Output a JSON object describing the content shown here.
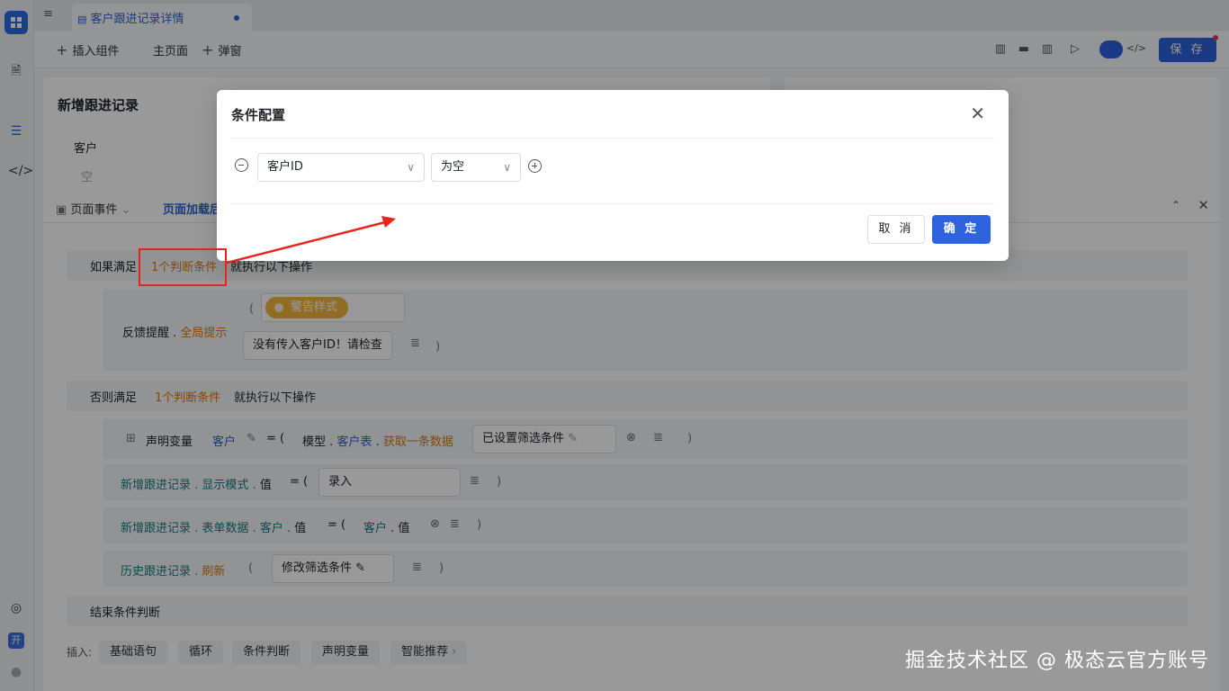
{
  "app": {
    "tab_title": "客户跟进记录详情",
    "open_badge": "开"
  },
  "toolbar": {
    "insert_component": "插入组件",
    "main_page": "主页面",
    "popup": "弹窗",
    "save": "保 存"
  },
  "canvas": {
    "title": "新增跟进记录",
    "field_label": "客户",
    "field_empty": "空"
  },
  "panel": {
    "tab_page_event": "页面事件",
    "tab_page_load": "页面加载后",
    "if_prefix": "如果满足",
    "if_condition": "1个判断条件",
    "if_suffix": "就执行以下操作",
    "feedback_label": "反馈提醒",
    "feedback_method": "全局提示",
    "warn_style": "警告样式",
    "warn_message": "没有传入客户ID！请检查",
    "else_prefix": "否则满足",
    "else_condition": "1个判断条件",
    "else_suffix": "就执行以下操作",
    "declare_label": "声明变量",
    "declare_var": "客户",
    "model_label": "模型",
    "model_table": "客户表",
    "model_action": "获取一条数据",
    "filter_set": "已设置筛选条件",
    "row2_target": "新增跟进记录",
    "row2_prop": "显示模式",
    "row2_val": "值",
    "row2_value": "录入",
    "row3_target": "新增跟进记录",
    "row3_prop": "表单数据",
    "row3_sub": "客户",
    "row3_val": "值",
    "row3_ref": "客户",
    "row3_ref_val": "值",
    "row4_target": "历史跟进记录",
    "row4_action": "刷新",
    "row4_filter": "修改筛选条件",
    "end_label": "结束条件判断"
  },
  "insert": {
    "label": "插入:",
    "items": [
      "基础语句",
      "循环",
      "条件判断",
      "声明变量",
      "智能推荐"
    ]
  },
  "modal": {
    "title": "条件配置",
    "field_select": "客户ID",
    "operator_select": "为空",
    "cancel": "取 消",
    "confirm": "确 定"
  },
  "watermark": "掘金技术社区 @ 极态云官方账号",
  "colors": {
    "primary": "#2e62e0",
    "orange": "#d97a10",
    "teal": "#0f7d86",
    "annotation_red": "#e8231c",
    "warn": "#f0b63b"
  }
}
